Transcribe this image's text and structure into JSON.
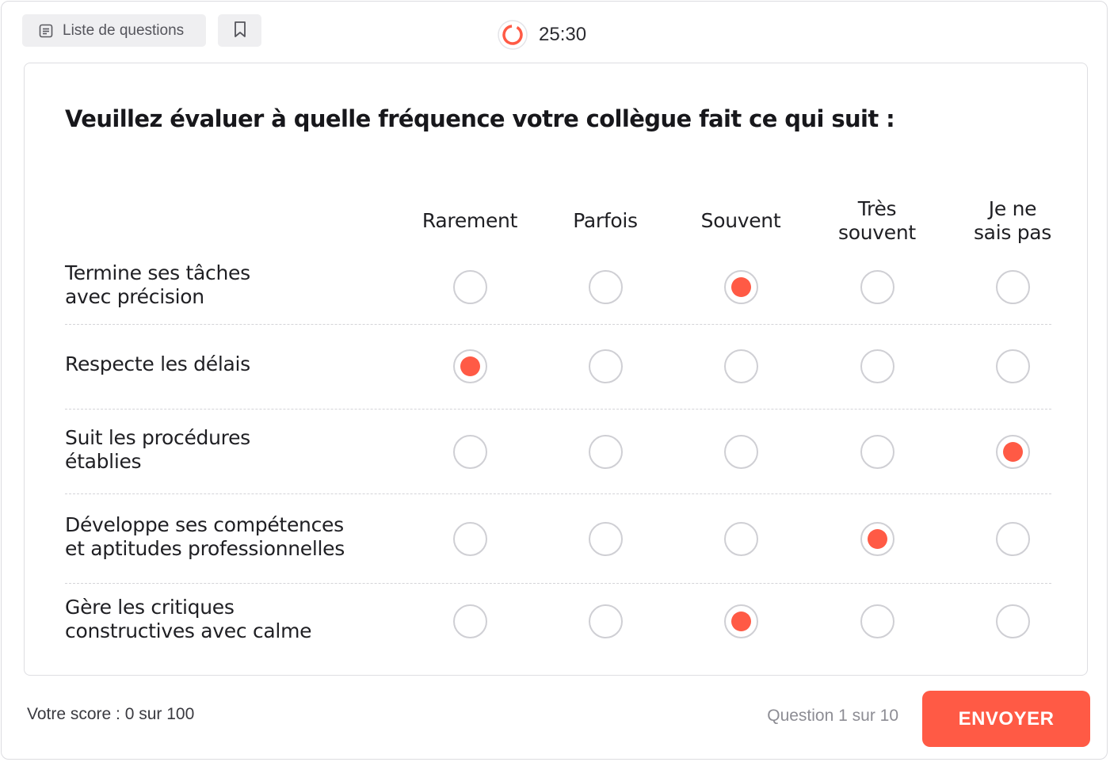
{
  "toolbar": {
    "question_list_label": "Liste de questions",
    "question_list_icon": "list-icon",
    "bookmark_icon": "bookmark-icon"
  },
  "timer": {
    "time": "25:30",
    "icon": "timer-ring-icon",
    "color": "#ff5a45"
  },
  "question": {
    "title": "Veuillez évaluer à quelle fréquence votre collègue fait ce qui suit :",
    "columns": [
      "Rarement",
      "Parfois",
      "Souvent",
      "Très\nsouvent",
      "Je ne\nsais pas"
    ],
    "rows": [
      {
        "label": "Termine ses tâches\navec précision",
        "selected": "Souvent"
      },
      {
        "label": "Respecte les délais",
        "selected": "Rarement"
      },
      {
        "label": "Suit les procédures\nétablies",
        "selected": "Je ne sais pas"
      },
      {
        "label": "Développe ses compétences\net aptitudes professionnelles",
        "selected": "Très souvent"
      },
      {
        "label": "Gère les critiques\nconstructives avec calme",
        "selected": "Souvent"
      }
    ]
  },
  "footer": {
    "score": "Votre score : 0 sur 100",
    "progress": "Question 1 sur 10",
    "submit_label": "ENVOYER"
  },
  "colors": {
    "accent": "#ff5a45",
    "button_bg": "#efeff1",
    "border": "#dedee2"
  }
}
